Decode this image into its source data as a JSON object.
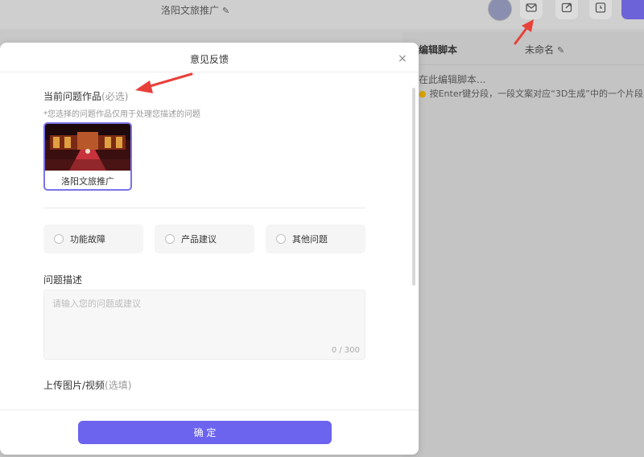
{
  "app": {
    "project_title": "洛阳文旅推广",
    "edit_glyph": "✎"
  },
  "script_panel": {
    "title": "编辑脚本",
    "name": "未命名",
    "placeholder": "在此编辑脚本...",
    "tip": "按Enter键分段，一段文案对应“3D生成”中的一个片段"
  },
  "modal": {
    "title": "意见反馈",
    "close_glyph": "×",
    "work_section": {
      "label": "当前问题作品",
      "optional": "(必选)",
      "hint": "*您选择的问题作品仅用于处理您描述的问题",
      "work_name": "洛阳文旅推广"
    },
    "types": [
      "功能故障",
      "产品建议",
      "其他问题"
    ],
    "description": {
      "label": "问题描述",
      "placeholder": "请输入您的问题或建议",
      "counter": "0 / 300"
    },
    "upload": {
      "label": "上传图片/视频",
      "optional": "(选填)"
    },
    "confirm_label": "确 定"
  },
  "colors": {
    "accent": "#6c63ef",
    "arrow": "#e8413a"
  }
}
